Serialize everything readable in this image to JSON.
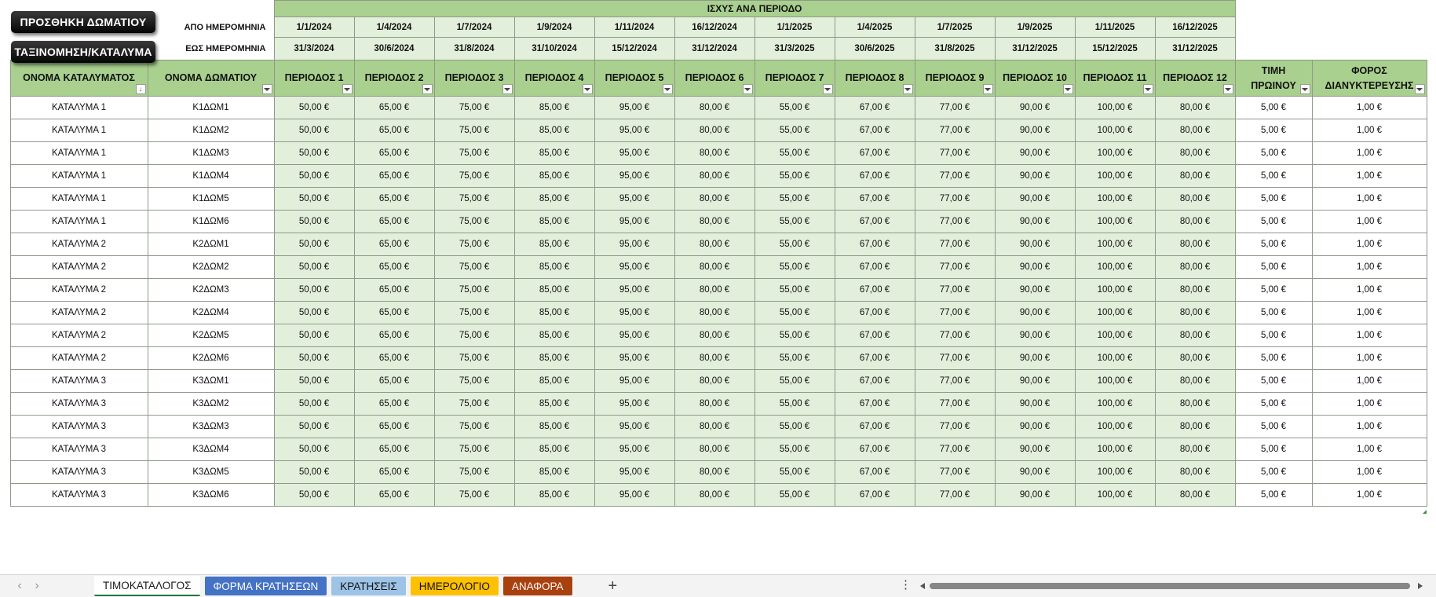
{
  "buttons": {
    "add_room": "ΠΡΟΣΘΗΚΗ ΔΩΜΑΤΙΟΥ",
    "sort": "ΤΑΞΙΝΟΜΗΣΗ/ΚΑΤΑΛΥΜΑ"
  },
  "period_header": {
    "title": "ΙΣΧΥΣ ΑΝΑ ΠΕΡΙΟΔΟ",
    "from_label": "ΑΠΟ ΗΜΕΡΟΜΗΝΙΑ",
    "to_label": "ΕΩΣ ΗΜΕΡΟΜΗΝΙΑ",
    "from_dates": [
      "1/1/2024",
      "1/4/2024",
      "1/7/2024",
      "1/9/2024",
      "1/11/2024",
      "16/12/2024",
      "1/1/2025",
      "1/4/2025",
      "1/7/2025",
      "1/9/2025",
      "1/11/2025",
      "16/12/2025"
    ],
    "to_dates": [
      "31/3/2024",
      "30/6/2024",
      "31/8/2024",
      "31/10/2024",
      "15/12/2024",
      "31/12/2024",
      "31/3/2025",
      "30/6/2025",
      "31/8/2025",
      "31/12/2025",
      "15/12/2025",
      "31/12/2025"
    ]
  },
  "columns": {
    "property": "ΟΝΟΜΑ ΚΑΤΑΛΥΜΑΤΟΣ",
    "room": "ΟΝΟΜΑ ΔΩΜΑΤΙΟΥ",
    "periods": [
      "ΠΕΡΙΟΔΟΣ 1",
      "ΠΕΡΙΟΔΟΣ 2",
      "ΠΕΡΙΟΔΟΣ 3",
      "ΠΕΡΙΟΔΟΣ 4",
      "ΠΕΡΙΟΔΟΣ 5",
      "ΠΕΡΙΟΔΟΣ 6",
      "ΠΕΡΙΟΔΟΣ 7",
      "ΠΕΡΙΟΔΟΣ 8",
      "ΠΕΡΙΟΔΟΣ 9",
      "ΠΕΡΙΟΔΟΣ 10",
      "ΠΕΡΙΟΔΟΣ 11",
      "ΠΕΡΙΟΔΟΣ 12"
    ],
    "breakfast_1": "ΤΙΜΗ",
    "breakfast_2": "ΠΡΩΙΝΟΥ",
    "tax_1": "ΦΟΡΟΣ",
    "tax_2": "ΔΙΑΝΥΚΤΕΡΕΥΣΗΣ"
  },
  "rows": [
    {
      "property": "ΚΑΤΑΛΥΜΑ 1",
      "room": "Κ1ΔΩΜ1",
      "prices": [
        "50,00 €",
        "65,00 €",
        "75,00 €",
        "85,00 €",
        "95,00 €",
        "80,00 €",
        "55,00 €",
        "67,00 €",
        "77,00 €",
        "90,00 €",
        "100,00 €",
        "80,00 €"
      ],
      "breakfast": "5,00 €",
      "tax": "1,00 €"
    },
    {
      "property": "ΚΑΤΑΛΥΜΑ 1",
      "room": "Κ1ΔΩΜ2",
      "prices": [
        "50,00 €",
        "65,00 €",
        "75,00 €",
        "85,00 €",
        "95,00 €",
        "80,00 €",
        "55,00 €",
        "67,00 €",
        "77,00 €",
        "90,00 €",
        "100,00 €",
        "80,00 €"
      ],
      "breakfast": "5,00 €",
      "tax": "1,00 €"
    },
    {
      "property": "ΚΑΤΑΛΥΜΑ 1",
      "room": "Κ1ΔΩΜ3",
      "prices": [
        "50,00 €",
        "65,00 €",
        "75,00 €",
        "85,00 €",
        "95,00 €",
        "80,00 €",
        "55,00 €",
        "67,00 €",
        "77,00 €",
        "90,00 €",
        "100,00 €",
        "80,00 €"
      ],
      "breakfast": "5,00 €",
      "tax": "1,00 €"
    },
    {
      "property": "ΚΑΤΑΛΥΜΑ 1",
      "room": "Κ1ΔΩΜ4",
      "prices": [
        "50,00 €",
        "65,00 €",
        "75,00 €",
        "85,00 €",
        "95,00 €",
        "80,00 €",
        "55,00 €",
        "67,00 €",
        "77,00 €",
        "90,00 €",
        "100,00 €",
        "80,00 €"
      ],
      "breakfast": "5,00 €",
      "tax": "1,00 €"
    },
    {
      "property": "ΚΑΤΑΛΥΜΑ 1",
      "room": "Κ1ΔΩΜ5",
      "prices": [
        "50,00 €",
        "65,00 €",
        "75,00 €",
        "85,00 €",
        "95,00 €",
        "80,00 €",
        "55,00 €",
        "67,00 €",
        "77,00 €",
        "90,00 €",
        "100,00 €",
        "80,00 €"
      ],
      "breakfast": "5,00 €",
      "tax": "1,00 €"
    },
    {
      "property": "ΚΑΤΑΛΥΜΑ 1",
      "room": "Κ1ΔΩΜ6",
      "prices": [
        "50,00 €",
        "65,00 €",
        "75,00 €",
        "85,00 €",
        "95,00 €",
        "80,00 €",
        "55,00 €",
        "67,00 €",
        "77,00 €",
        "90,00 €",
        "100,00 €",
        "80,00 €"
      ],
      "breakfast": "5,00 €",
      "tax": "1,00 €"
    },
    {
      "property": "ΚΑΤΑΛΥΜΑ 2",
      "room": "Κ2ΔΩΜ1",
      "prices": [
        "50,00 €",
        "65,00 €",
        "75,00 €",
        "85,00 €",
        "95,00 €",
        "80,00 €",
        "55,00 €",
        "67,00 €",
        "77,00 €",
        "90,00 €",
        "100,00 €",
        "80,00 €"
      ],
      "breakfast": "5,00 €",
      "tax": "1,00 €"
    },
    {
      "property": "ΚΑΤΑΛΥΜΑ 2",
      "room": "Κ2ΔΩΜ2",
      "prices": [
        "50,00 €",
        "65,00 €",
        "75,00 €",
        "85,00 €",
        "95,00 €",
        "80,00 €",
        "55,00 €",
        "67,00 €",
        "77,00 €",
        "90,00 €",
        "100,00 €",
        "80,00 €"
      ],
      "breakfast": "5,00 €",
      "tax": "1,00 €"
    },
    {
      "property": "ΚΑΤΑΛΥΜΑ 2",
      "room": "Κ2ΔΩΜ3",
      "prices": [
        "50,00 €",
        "65,00 €",
        "75,00 €",
        "85,00 €",
        "95,00 €",
        "80,00 €",
        "55,00 €",
        "67,00 €",
        "77,00 €",
        "90,00 €",
        "100,00 €",
        "80,00 €"
      ],
      "breakfast": "5,00 €",
      "tax": "1,00 €"
    },
    {
      "property": "ΚΑΤΑΛΥΜΑ 2",
      "room": "Κ2ΔΩΜ4",
      "prices": [
        "50,00 €",
        "65,00 €",
        "75,00 €",
        "85,00 €",
        "95,00 €",
        "80,00 €",
        "55,00 €",
        "67,00 €",
        "77,00 €",
        "90,00 €",
        "100,00 €",
        "80,00 €"
      ],
      "breakfast": "5,00 €",
      "tax": "1,00 €"
    },
    {
      "property": "ΚΑΤΑΛΥΜΑ 2",
      "room": "Κ2ΔΩΜ5",
      "prices": [
        "50,00 €",
        "65,00 €",
        "75,00 €",
        "85,00 €",
        "95,00 €",
        "80,00 €",
        "55,00 €",
        "67,00 €",
        "77,00 €",
        "90,00 €",
        "100,00 €",
        "80,00 €"
      ],
      "breakfast": "5,00 €",
      "tax": "1,00 €"
    },
    {
      "property": "ΚΑΤΑΛΥΜΑ 2",
      "room": "Κ2ΔΩΜ6",
      "prices": [
        "50,00 €",
        "65,00 €",
        "75,00 €",
        "85,00 €",
        "95,00 €",
        "80,00 €",
        "55,00 €",
        "67,00 €",
        "77,00 €",
        "90,00 €",
        "100,00 €",
        "80,00 €"
      ],
      "breakfast": "5,00 €",
      "tax": "1,00 €"
    },
    {
      "property": "ΚΑΤΑΛΥΜΑ 3",
      "room": "Κ3ΔΩΜ1",
      "prices": [
        "50,00 €",
        "65,00 €",
        "75,00 €",
        "85,00 €",
        "95,00 €",
        "80,00 €",
        "55,00 €",
        "67,00 €",
        "77,00 €",
        "90,00 €",
        "100,00 €",
        "80,00 €"
      ],
      "breakfast": "5,00 €",
      "tax": "1,00 €"
    },
    {
      "property": "ΚΑΤΑΛΥΜΑ 3",
      "room": "Κ3ΔΩΜ2",
      "prices": [
        "50,00 €",
        "65,00 €",
        "75,00 €",
        "85,00 €",
        "95,00 €",
        "80,00 €",
        "55,00 €",
        "67,00 €",
        "77,00 €",
        "90,00 €",
        "100,00 €",
        "80,00 €"
      ],
      "breakfast": "5,00 €",
      "tax": "1,00 €"
    },
    {
      "property": "ΚΑΤΑΛΥΜΑ 3",
      "room": "Κ3ΔΩΜ3",
      "prices": [
        "50,00 €",
        "65,00 €",
        "75,00 €",
        "85,00 €",
        "95,00 €",
        "80,00 €",
        "55,00 €",
        "67,00 €",
        "77,00 €",
        "90,00 €",
        "100,00 €",
        "80,00 €"
      ],
      "breakfast": "5,00 €",
      "tax": "1,00 €"
    },
    {
      "property": "ΚΑΤΑΛΥΜΑ 3",
      "room": "Κ3ΔΩΜ4",
      "prices": [
        "50,00 €",
        "65,00 €",
        "75,00 €",
        "85,00 €",
        "95,00 €",
        "80,00 €",
        "55,00 €",
        "67,00 €",
        "77,00 €",
        "90,00 €",
        "100,00 €",
        "80,00 €"
      ],
      "breakfast": "5,00 €",
      "tax": "1,00 €"
    },
    {
      "property": "ΚΑΤΑΛΥΜΑ 3",
      "room": "Κ3ΔΩΜ5",
      "prices": [
        "50,00 €",
        "65,00 €",
        "75,00 €",
        "85,00 €",
        "95,00 €",
        "80,00 €",
        "55,00 €",
        "67,00 €",
        "77,00 €",
        "90,00 €",
        "100,00 €",
        "80,00 €"
      ],
      "breakfast": "5,00 €",
      "tax": "1,00 €"
    },
    {
      "property": "ΚΑΤΑΛΥΜΑ 3",
      "room": "Κ3ΔΩΜ6",
      "prices": [
        "50,00 €",
        "65,00 €",
        "75,00 €",
        "85,00 €",
        "95,00 €",
        "80,00 €",
        "55,00 €",
        "67,00 €",
        "77,00 €",
        "90,00 €",
        "100,00 €",
        "80,00 €"
      ],
      "breakfast": "5,00 €",
      "tax": "1,00 €"
    }
  ],
  "tabs": [
    {
      "label": "ΤΙΜΟΚΑΤΑΛΟΓΟΣ",
      "color": "#ffffff",
      "active": true
    },
    {
      "label": "ΦΟΡΜΑ ΚΡΑΤΗΣΕΩΝ",
      "color": "#4472c4",
      "active": false
    },
    {
      "label": "ΚΡΑΤΗΣΕΙΣ",
      "color": "#9dc3e6",
      "active": false
    },
    {
      "label": "ΗΜΕΡΟΛΟΓΙΟ",
      "color": "#ffc000",
      "active": false
    },
    {
      "label": "ΑΝΑΦΟΡΑ",
      "color": "#a9410f",
      "active": false
    }
  ],
  "icons": {
    "prev_sheet": "chevron-left-icon",
    "next_sheet": "chevron-right-icon",
    "add_sheet": "plus-icon",
    "more": "vertical-dots-icon"
  }
}
